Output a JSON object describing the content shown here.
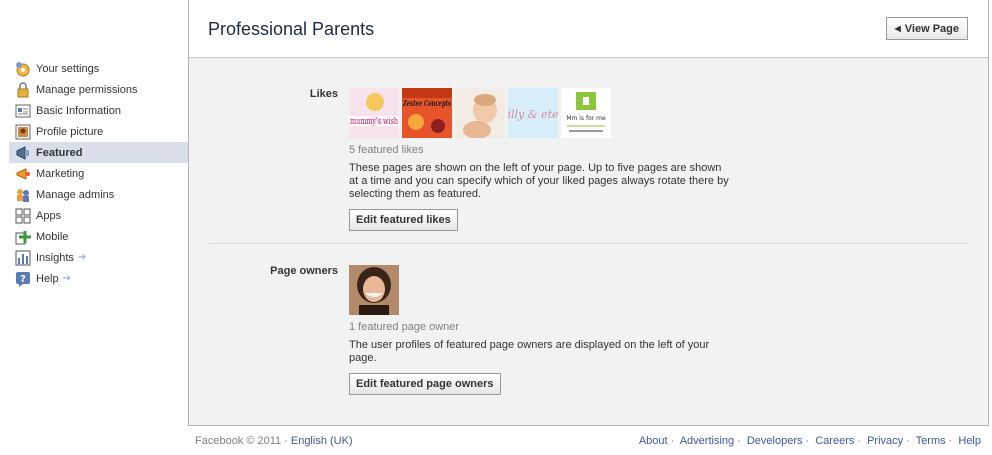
{
  "sidebar": {
    "items": [
      {
        "label": "Your settings",
        "icon": "settings-icon"
      },
      {
        "label": "Manage permissions",
        "icon": "lock-icon"
      },
      {
        "label": "Basic Information",
        "icon": "info-icon"
      },
      {
        "label": "Profile picture",
        "icon": "picture-icon"
      },
      {
        "label": "Featured",
        "icon": "megaphone-icon",
        "active": true
      },
      {
        "label": "Marketing",
        "icon": "marketing-icon"
      },
      {
        "label": "Manage admins",
        "icon": "admins-icon"
      },
      {
        "label": "Apps",
        "icon": "apps-icon"
      },
      {
        "label": "Mobile",
        "icon": "mobile-icon"
      },
      {
        "label": "Insights",
        "icon": "insights-icon",
        "arrow": "➔"
      },
      {
        "label": "Help",
        "icon": "help-icon",
        "arrow": "➔"
      }
    ]
  },
  "header": {
    "title": "Professional Parents",
    "view_page": "View Page"
  },
  "likes": {
    "label": "Likes",
    "thumbs": [
      {
        "text": "mummy's wish"
      },
      {
        "text": "Zestee Concepts"
      },
      {
        "text": ""
      },
      {
        "text": "illy & ete"
      },
      {
        "text": "Mm is for me"
      }
    ],
    "count": "5 featured likes",
    "description": "These pages are shown on the left of your page. Up to five pages are shown at a time and you can specify which of your liked pages always rotate there by selecting them as featured.",
    "button": "Edit featured likes"
  },
  "owners": {
    "label": "Page owners",
    "count": "1 featured page owner",
    "description": "The user profiles of featured page owners are displayed on the left of your page.",
    "button": "Edit featured page owners"
  },
  "footer": {
    "copyright": "Facebook © 2011",
    "language": "English (UK)",
    "links": [
      "About",
      "Advertising",
      "Developers",
      "Careers",
      "Privacy",
      "Terms",
      "Help"
    ]
  }
}
